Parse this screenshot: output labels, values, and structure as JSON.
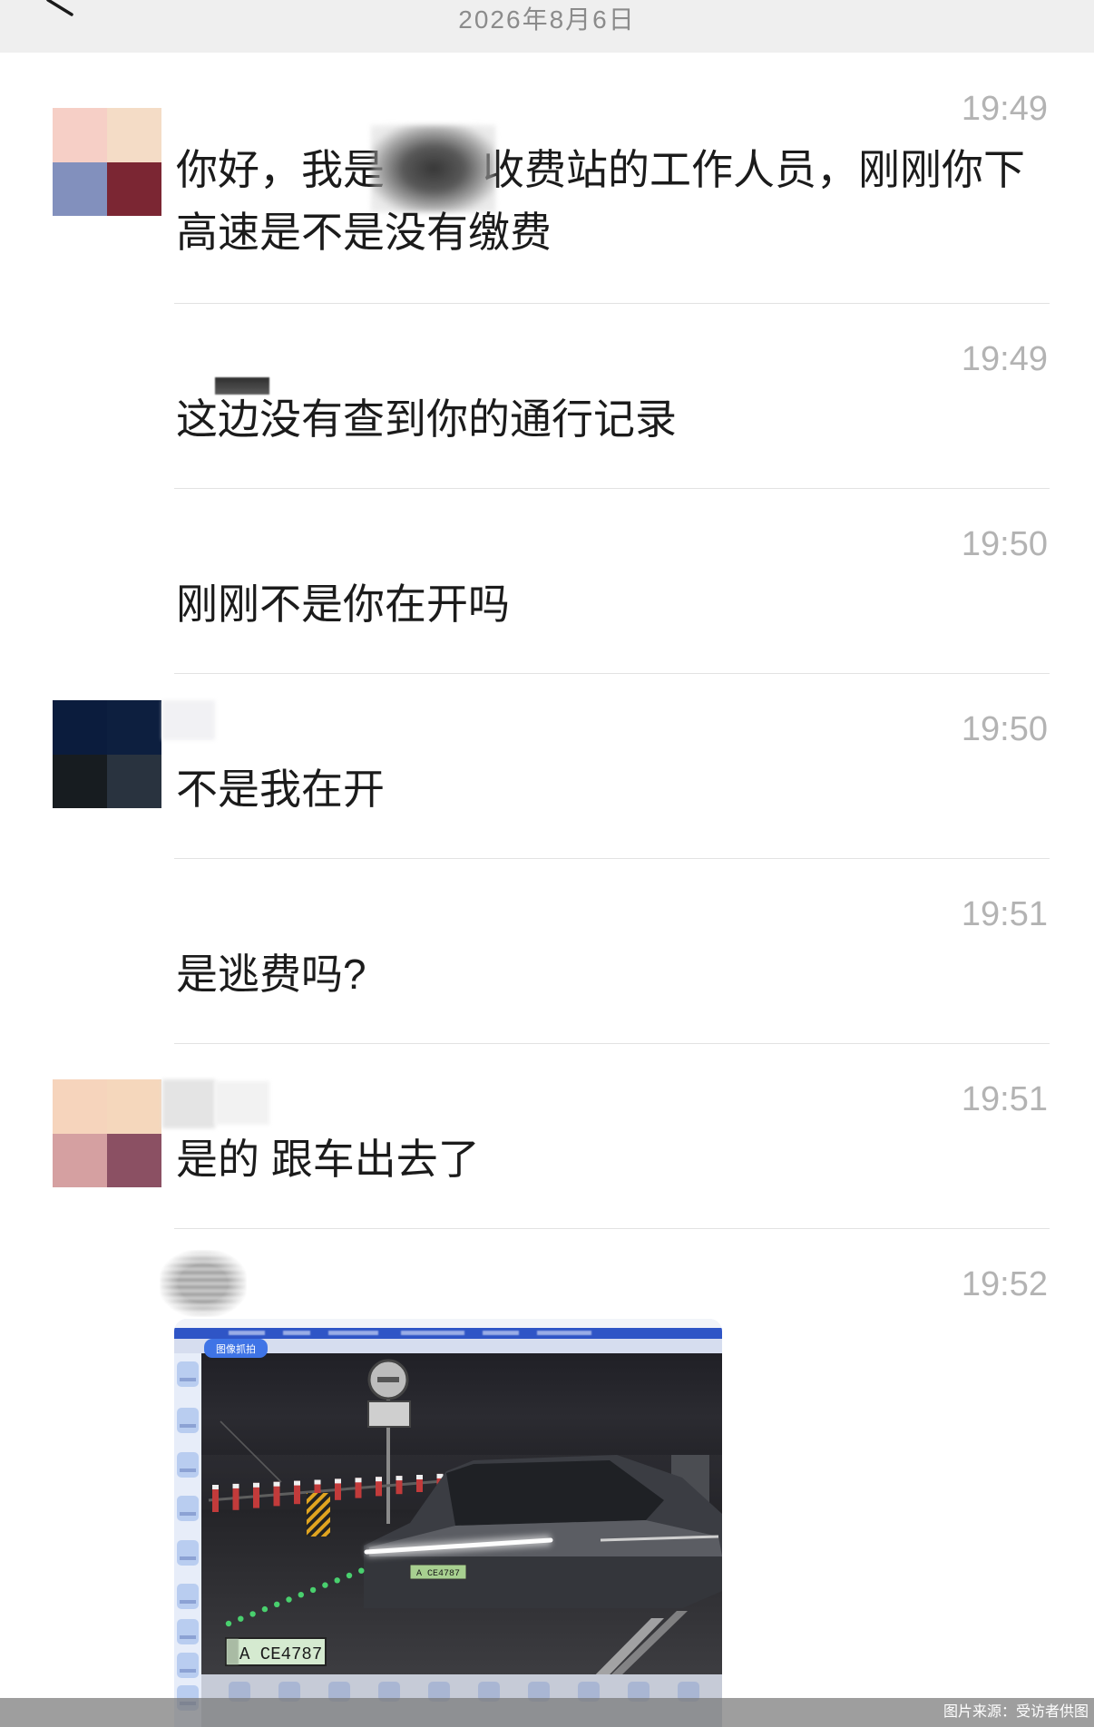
{
  "header": {
    "date": "2026年8月6日",
    "back_icon": "chevron-left-icon"
  },
  "messages": [
    {
      "time": "19:49",
      "text_before_redaction": "你好，我是",
      "text_after_redaction": "收费站的工作人员，刚刚你下",
      "text_line2": "高速是不是没有缴费"
    },
    {
      "time": "19:49",
      "text": "这边没有查到你的通行记录"
    },
    {
      "time": "19:50",
      "text": "刚刚不是你在开吗"
    },
    {
      "time": "19:50",
      "text": "不是我在开"
    },
    {
      "time": "19:51",
      "text": "是逃费吗?"
    },
    {
      "time": "19:51",
      "text": "是的 跟车出去了"
    },
    {
      "time": "19:52",
      "image": {
        "capture_button_label": "图像抓拍",
        "vehicle_plate": "A CE4787",
        "zoomed_plate": "A CE4787"
      }
    }
  ],
  "caption": "图片来源：受访者供图",
  "colors": {
    "header_background": "#efefef",
    "message_text": "#1b1b1b",
    "timestamp": "#b3b3b3",
    "capture_button": "#3f74e6"
  }
}
